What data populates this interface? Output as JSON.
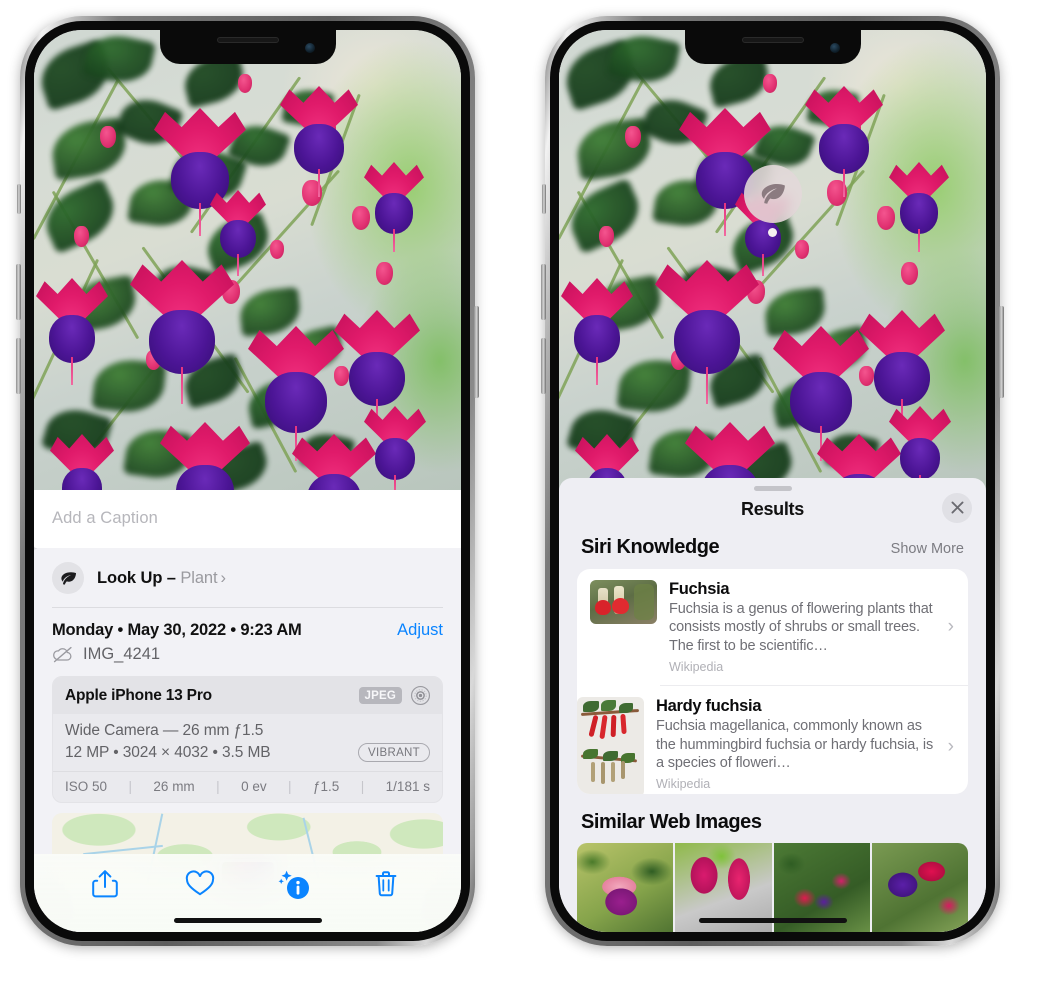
{
  "left_phone": {
    "caption_placeholder": "Add a Caption",
    "lookup": {
      "icon": "leaf-icon",
      "label": "Look Up –",
      "subject": "Plant",
      "chevron": "›"
    },
    "datetime": "Monday • May 30, 2022 • 9:23 AM",
    "adjust_label": "Adjust",
    "filename": "IMG_4241",
    "cloud_icon": "cloud-slash-icon",
    "exif": {
      "device": "Apple iPhone 13 Pro",
      "format_badge": "JPEG",
      "lens_icon": "lens-circle-icon",
      "camera_line": "Wide Camera — 26 mm ƒ1.5",
      "size_line": "12 MP • 3024 × 4032 • 3.5 MB",
      "style_badge": "VIBRANT",
      "stats": [
        "ISO 50",
        "26 mm",
        "0 ev",
        "ƒ1.5",
        "1/181 s"
      ],
      "stat_separator": "|"
    },
    "toolbar": [
      {
        "name": "share-icon",
        "label": "Share"
      },
      {
        "name": "heart-icon",
        "label": "Favorite"
      },
      {
        "name": "info-sparkle-icon",
        "label": "Info"
      },
      {
        "name": "trash-icon",
        "label": "Delete"
      }
    ]
  },
  "right_phone": {
    "visual_lookup_badge": "leaf-icon",
    "sheet_title": "Results",
    "close_icon": "close-icon",
    "sections": [
      {
        "title": "Siri Knowledge",
        "action": "Show More",
        "cards": [
          {
            "title": "Fuchsia",
            "description": "Fuchsia is a genus of flowering plants that consists mostly of shrubs or small trees. The first to be scientific…",
            "source": "Wikipedia",
            "chevron": "›"
          },
          {
            "title": "Hardy fuchsia",
            "description": "Fuchsia magellanica, commonly known as the hummingbird fuchsia or hardy fuchsia, is a species of floweri…",
            "source": "Wikipedia",
            "chevron": "›"
          }
        ]
      },
      {
        "title": "Similar Web Images",
        "action": "",
        "thumbnails": [
          "web-image-1",
          "web-image-2",
          "web-image-3",
          "web-image-4"
        ]
      }
    ]
  },
  "colors": {
    "accent_blue": "#0a84ff",
    "sheet_bg": "#eeeef3",
    "card_bg": "#ffffff",
    "primary_text": "#0b0b0c",
    "secondary_text": "#6f6f75",
    "tertiary_text": "#b0b0b6"
  }
}
